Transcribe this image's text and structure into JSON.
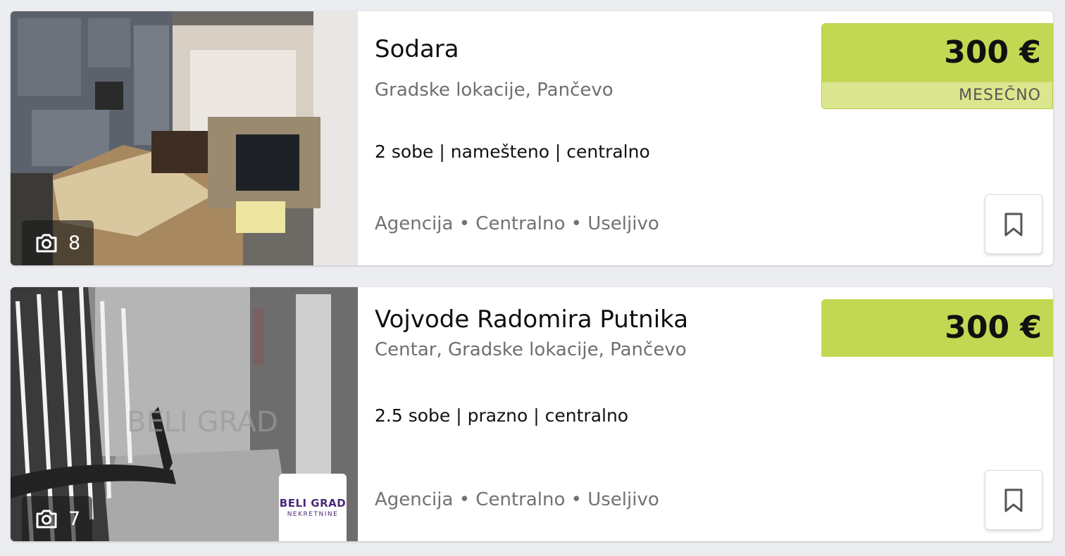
{
  "listings": [
    {
      "title": "Sodara",
      "location": "Gradske lokacije, Pančevo",
      "specs": "2 sobe | nameš­teno | centralno",
      "tags": "Agencija • Centralno • Useljivo",
      "price": "300 €",
      "price_period": "MESEČNO",
      "photo_count": "8",
      "colors": {
        "price_bg": "#c3d852",
        "period_bg": "#dbe68e"
      }
    },
    {
      "title": "Vojvode Radomira Putnika",
      "location": "Centar, Gradske lokacije, Pančevo",
      "specs": "2.5 sobe | prazno | centralno",
      "tags": "Agencija • Centralno • Useljivo",
      "price": "300 €",
      "photo_count": "7",
      "agency_logo": {
        "main": "BELI GRAD",
        "sub": "NEKRETNINE"
      }
    }
  ]
}
